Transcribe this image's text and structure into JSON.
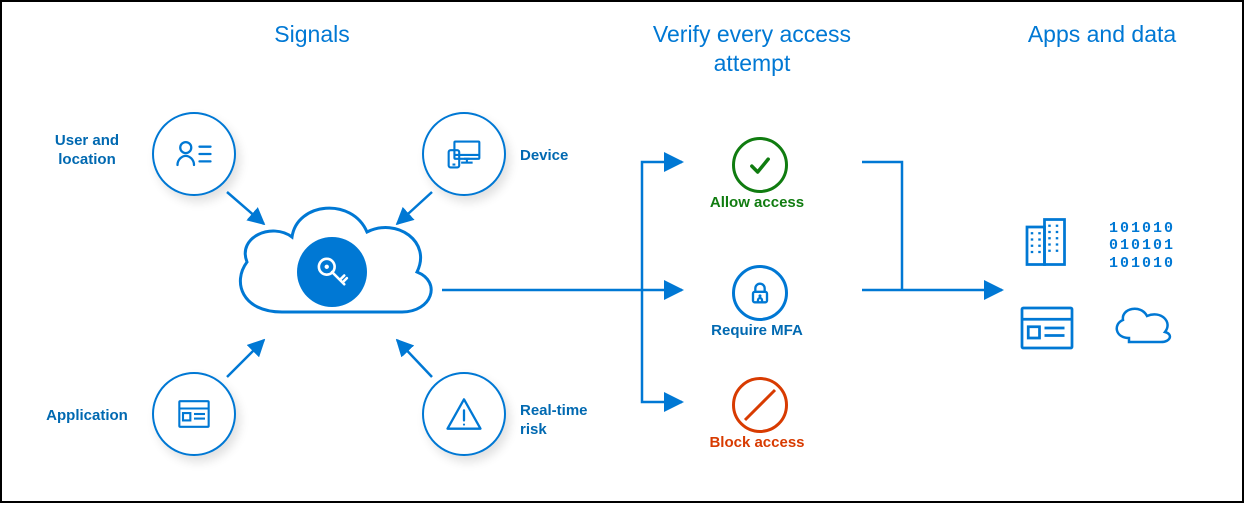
{
  "colors": {
    "primary": "#0078d4",
    "primary_dark": "#0169b1",
    "green": "#107c10",
    "red": "#d83b01"
  },
  "headings": {
    "signals": "Signals",
    "verify": "Verify every access attempt",
    "apps": "Apps and data"
  },
  "signals": {
    "user_location": "User and location",
    "device": "Device",
    "application": "Application",
    "realtime_risk": "Real-time risk"
  },
  "decisions": {
    "allow": "Allow access",
    "require_mfa": "Require MFA",
    "block": "Block access"
  },
  "binary": "101010\n010101\n101010"
}
